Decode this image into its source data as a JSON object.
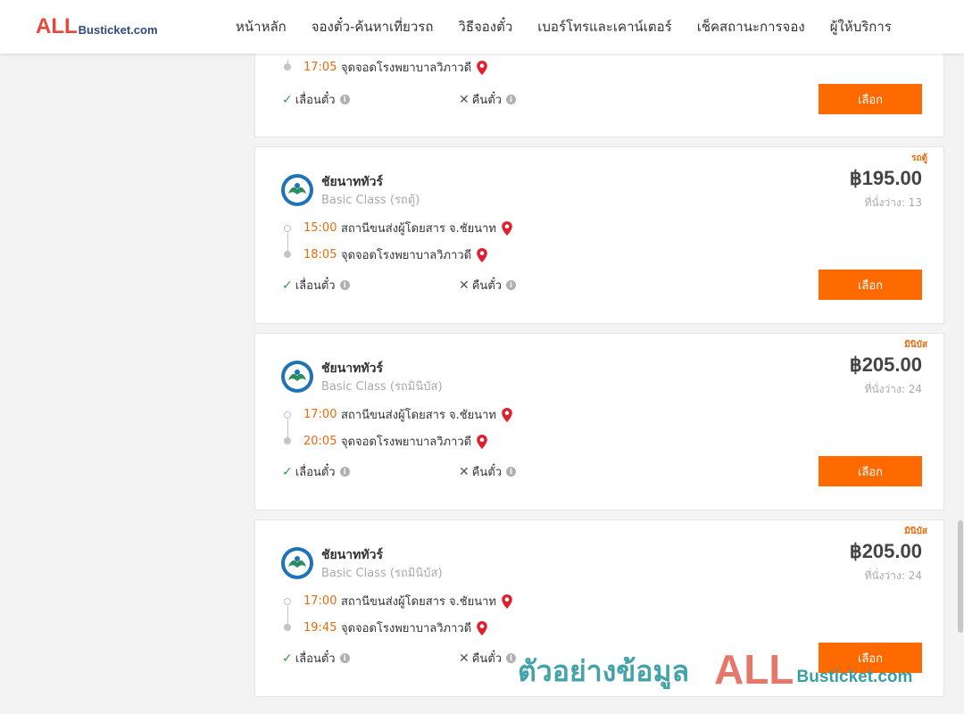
{
  "header": {
    "logo_main": "ALL",
    "logo_sub": "Busticket.com",
    "nav": [
      "หน้าหลัก",
      "จองตั๋ว-ค้นหาเที่ยวรถ",
      "วิธีจองตั๋ว",
      "เบอร์โทรและเคาน์เตอร์",
      "เช็คสถานะการจอง",
      "ผู้ให้บริการ"
    ]
  },
  "partial_trip": {
    "arrive_time": "17:05",
    "arrive_place": "จุดจอดโรงพยาบาลวิภาวดี",
    "reschedule": "เลื่อนตั๋ว",
    "refund": "คืนตั๋ว",
    "select": "เลือก"
  },
  "trips": [
    {
      "badge": "รถตู้",
      "operator": "ชัยนาททัวร์",
      "bus_class": "Basic Class (รถตู้)",
      "price": "฿195.00",
      "seats": "ที่นั่งว่าง: 13",
      "depart_time": "15:00",
      "depart_place": "สถานีขนส่งผู้โดยสาร จ.ชัยนาท",
      "arrive_time": "18:05",
      "arrive_place": "จุดจอดโรงพยาบาลวิภาวดี",
      "reschedule": "เลื่อนตั๋ว",
      "refund": "คืนตั๋ว",
      "select": "เลือก"
    },
    {
      "badge": "มินิบัส",
      "operator": "ชัยนาททัวร์",
      "bus_class": "Basic Class (รถมินิบัส)",
      "price": "฿205.00",
      "seats": "ที่นั่งว่าง: 24",
      "depart_time": "17:00",
      "depart_place": "สถานีขนส่งผู้โดยสาร จ.ชัยนาท",
      "arrive_time": "20:05",
      "arrive_place": "จุดจอดโรงพยาบาลวิภาวดี",
      "reschedule": "เลื่อนตั๋ว",
      "refund": "คืนตั๋ว",
      "select": "เลือก"
    },
    {
      "badge": "มินิบัส",
      "operator": "ชัยนาททัวร์",
      "bus_class": "Basic Class (รถมินิบัส)",
      "price": "฿205.00",
      "seats": "ที่นั่งว่าง: 24",
      "depart_time": "17:00",
      "depart_place": "สถานีขนส่งผู้โดยสาร จ.ชัยนาท",
      "arrive_time": "19:45",
      "arrive_place": "จุดจอดโรงพยาบาลวิภาวดี",
      "reschedule": "เลื่อนตั๋ว",
      "refund": "คืนตั๋ว",
      "select": "เลือก"
    }
  ],
  "watermark": {
    "text": "ตัวอย่างข้อมูล",
    "logo_main": "ALL",
    "logo_sub": "Busticket.com"
  },
  "colors": {
    "accent": "#ff6a00",
    "time": "#ea6a0c",
    "check": "#2e9e3a",
    "pin": "#e0202f",
    "logo_red": "#e9473b",
    "logo_blue": "#2e4a7d"
  },
  "icons": {
    "check": "check-icon",
    "cross": "cross-icon",
    "info": "info-icon",
    "pin": "map-pin-icon"
  }
}
